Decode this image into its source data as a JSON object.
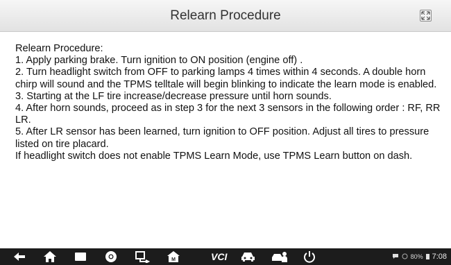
{
  "header": {
    "title": "Relearn Procedure"
  },
  "procedure": {
    "lines": [
      "Relearn Procedure:",
      "1. Apply parking brake. Turn ignition to ON position (engine off) .",
      "2. Turn headlight switch from OFF to parking lamps 4 times within 4 seconds. A double horn chirp will sound and the TPMS telltale will begin blinking to indicate the learn mode is enabled.",
      "3. Starting at the LF tire increase/decrease pressure until horn sounds.",
      "4. After horn sounds, proceed as in step 3 for the next 3 sensors in the following order : RF, RR LR.",
      "5. After LR sensor has been learned, turn ignition to OFF position. Adjust all tires to pressure listed on tire placard.",
      "If headlight switch does not enable TPMS Learn Mode, use TPMS Learn button on dash."
    ]
  },
  "navbar": {
    "vci_label": "VCI",
    "icons": [
      "back-icon",
      "home-icon",
      "recent-apps-icon",
      "browser-icon",
      "screenshot-icon",
      "maxifix-icon",
      "vci-icon",
      "car-icon",
      "shop-manager-icon",
      "power-icon"
    ]
  },
  "status": {
    "battery": "80%",
    "time": "7:08"
  }
}
